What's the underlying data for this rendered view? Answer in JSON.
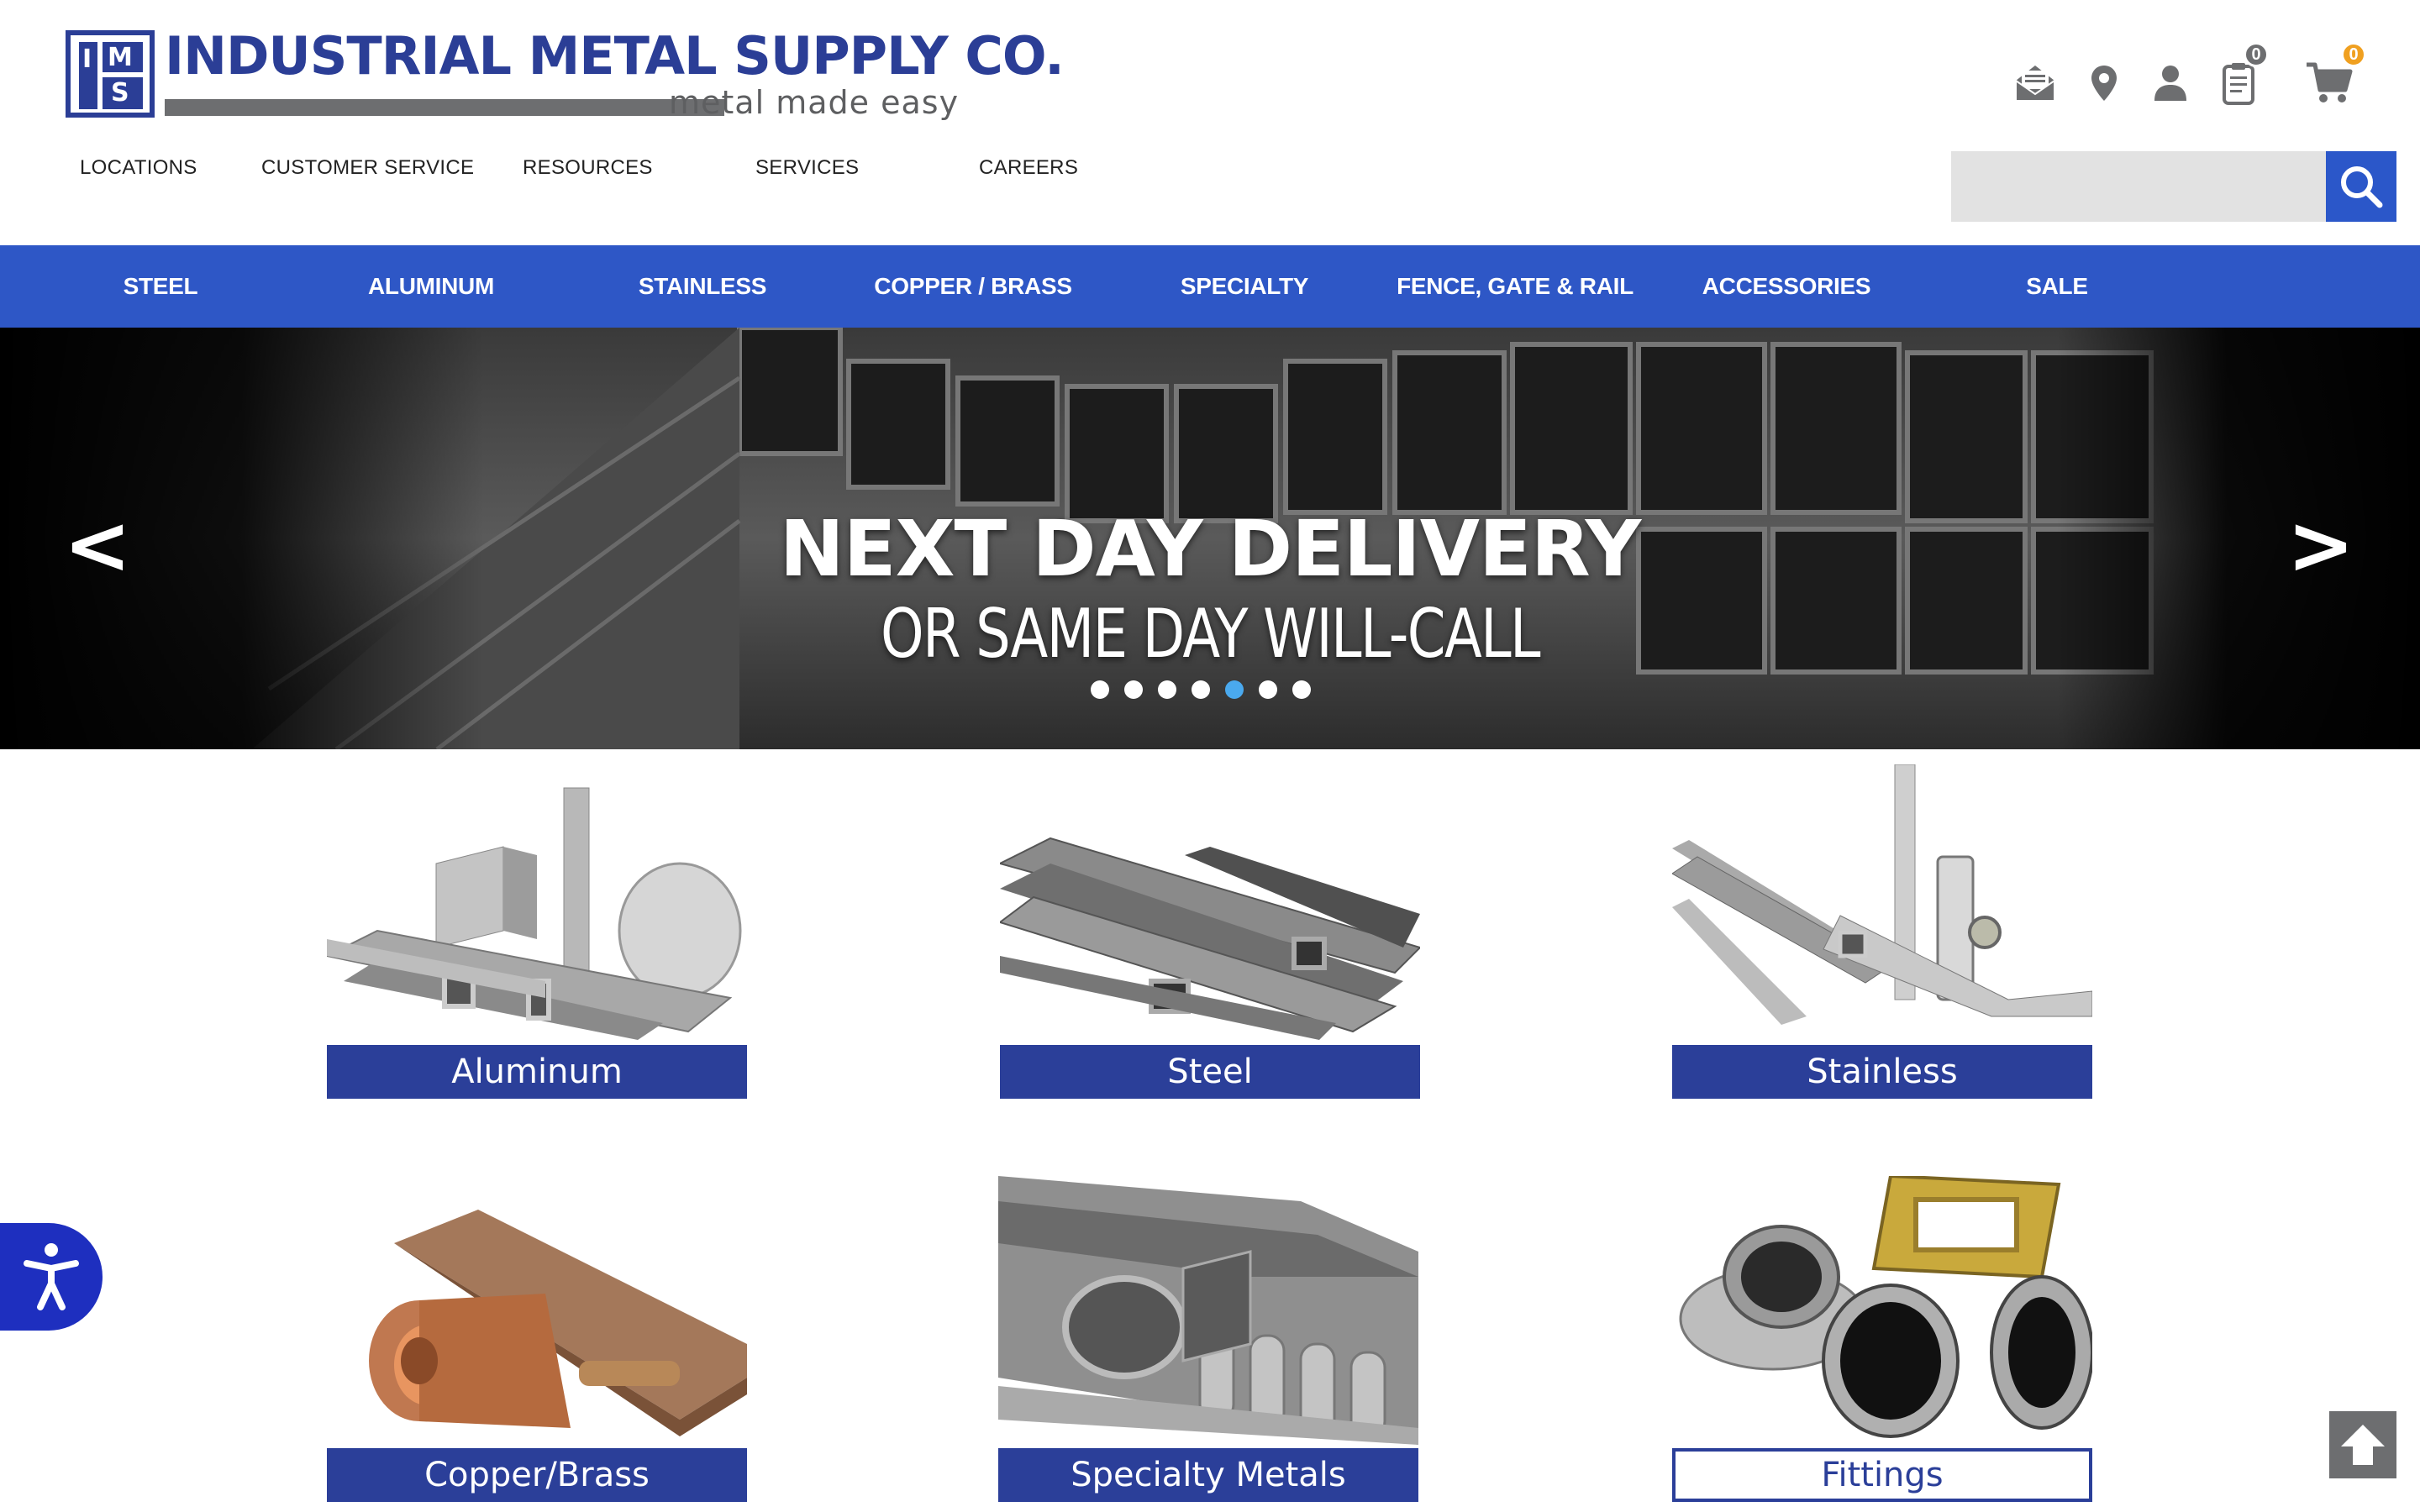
{
  "logo": {
    "name": "Industrial Metal Supply Co.",
    "tagline": "metal made easy",
    "mark_letters": [
      "I",
      "M",
      "S"
    ]
  },
  "utility": {
    "items": [
      {
        "icon": "mail-icon"
      },
      {
        "icon": "location-pin-icon"
      },
      {
        "icon": "account-icon"
      },
      {
        "icon": "quote-list-icon",
        "badge": "0"
      },
      {
        "icon": "cart-icon",
        "badge": "0"
      }
    ]
  },
  "top_nav": [
    "LOCATIONS",
    "CUSTOMER SERVICE",
    "RESOURCES",
    "SERVICES",
    "CAREERS"
  ],
  "search": {
    "placeholder": "",
    "value": ""
  },
  "category_nav": [
    "STEEL",
    "ALUMINUM",
    "STAINLESS",
    "COPPER / BRASS",
    "SPECIALTY",
    "FENCE, GATE & RAIL",
    "ACCESSORIES",
    "SALE"
  ],
  "hero": {
    "title": "NEXT DAY DELIVERY",
    "subtitle": "OR SAME DAY WILL-CALL",
    "prev": "<",
    "next": ">",
    "slide_count": 7,
    "active_slide": 5
  },
  "products": [
    "Aluminum",
    "Steel",
    "Stainless",
    "Copper/Brass",
    "Specialty Metals",
    "Fittings"
  ],
  "colors": {
    "brand_blue": "#2b3e96",
    "nav_blue": "#2e57c6",
    "badge_orange": "#f0a020",
    "dot_active": "#4aa9ee"
  }
}
